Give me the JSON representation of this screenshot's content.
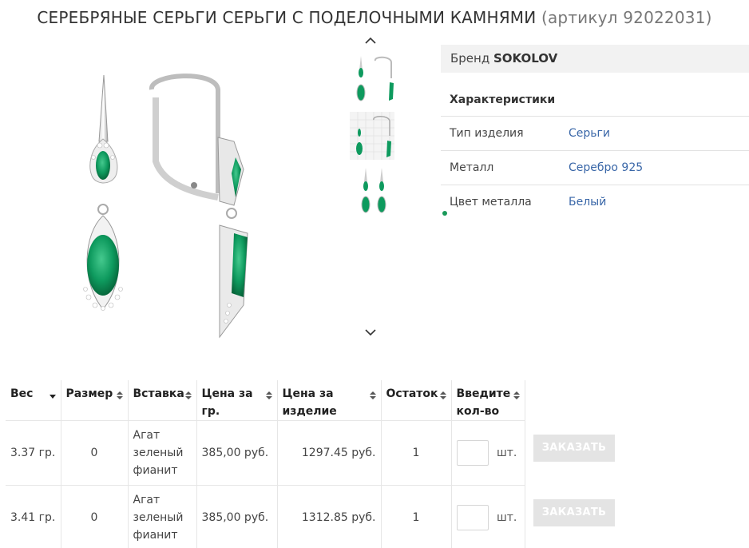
{
  "product": {
    "title": "СЕРЕБРЯНЫЕ СЕРЬГИ СЕРЬГИ С ПОДЕЛОЧНЫМИ КАМНЯМИ",
    "sku": "(артикул 92022031)"
  },
  "gallery": {
    "main_image": "earrings-main-photo",
    "thumbnails": [
      "earrings-thumb-1",
      "earrings-thumb-2",
      "earrings-thumb-3"
    ],
    "up_icon": "chevron-up-icon",
    "down_icon": "chevron-down-icon"
  },
  "specs": {
    "brand_label": "Бренд",
    "brand_value": "SOKOLOV",
    "heading": "Характеристики",
    "rows": [
      {
        "key": "Тип изделия",
        "value": "Серьги"
      },
      {
        "key": "Металл",
        "value": "Серебро 925"
      },
      {
        "key": "Цвет металла",
        "value": "Белый"
      }
    ]
  },
  "table": {
    "headers": {
      "weight": "Вес",
      "size": "Размер",
      "insert": "Вставка",
      "price_gram_1": "Цена за",
      "price_gram_2": "гр.",
      "price_item_1": "Цена за",
      "price_item_2": "изделие",
      "stock": "Остаток",
      "qty_1": "Введите",
      "qty_2": "кол-во"
    },
    "rows": [
      {
        "weight": "3.37 гр.",
        "size": "0",
        "insert_1": "Агат",
        "insert_2": "зеленый",
        "insert_3": "фианит",
        "price_gram": "385,00 руб.",
        "price_item": "1297.45 руб.",
        "stock": "1",
        "qty": "",
        "unit": "шт.",
        "order": "ЗАКАЗАТЬ"
      },
      {
        "weight": "3.41 гр.",
        "size": "0",
        "insert_1": "Агат",
        "insert_2": "зеленый",
        "insert_3": "фианит",
        "price_gram": "385,00 руб.",
        "price_item": "1312.85 руб.",
        "stock": "1",
        "qty": "",
        "unit": "шт.",
        "order": "ЗАКАЗАТЬ"
      }
    ]
  },
  "colors": {
    "link": "#3a67a8",
    "gem": "#0e9a5e",
    "button": "#e4e4e4"
  }
}
